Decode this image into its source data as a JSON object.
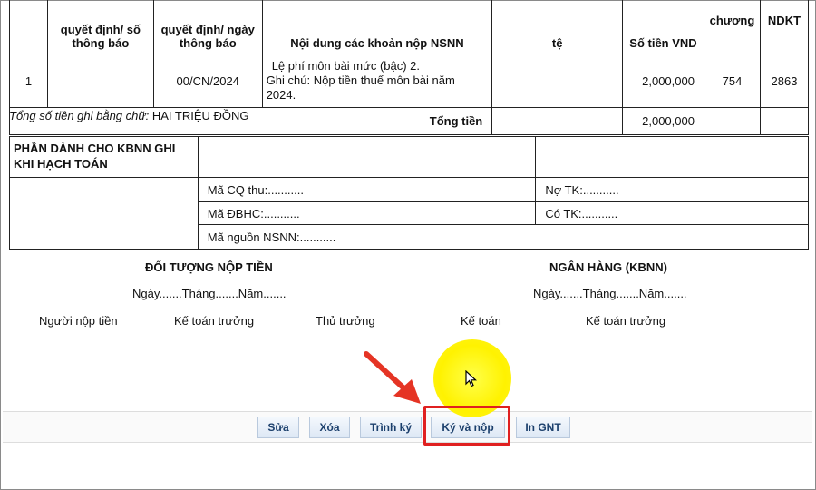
{
  "table_headers": [
    "",
    "quyết định/ số thông báo",
    "quyết định/ ngày thông báo",
    "Nội dung các khoản nộp NSNN",
    "tệ",
    "Số tiền VND",
    "chương",
    "NDKT"
  ],
  "row": {
    "stt": "1",
    "so_thong_bao": "",
    "ngay": "00/CN/2024",
    "noi_dung_1": "Lệ phí môn bài mức (bậc) 2.",
    "noi_dung_2": "Ghi chú: Nộp tiền thuế môn bài năm",
    "noi_dung_3": "2024.",
    "te": "",
    "so_tien": "2,000,000",
    "chuong": "754",
    "ndkt": "2863"
  },
  "total": {
    "label": "Tổng tiền",
    "value": "2,000,000"
  },
  "amount_words": {
    "prefix": "Tổng số tiền ghi bằng chữ:",
    "value": "HAI TRIỆU ĐỒNG"
  },
  "kbnn": {
    "title": "PHẦN DÀNH CHO KBNN GHI KHI HẠCH TOÁN",
    "ma_cq_thu": "Mã CQ thu:...........",
    "no_tk": "Nợ TK:...........",
    "ma_dbhc": "Mã ĐBHC:...........",
    "co_tk": "Có TK:...........",
    "ma_nguon": "Mã nguồn NSNN:..........."
  },
  "signatures": {
    "left_title": "ĐỐI TƯỢNG NỘP TIỀN",
    "right_title": "NGÂN HÀNG (KBNN)",
    "date_left": "Ngày.......Tháng.......Năm.......",
    "date_right": "Ngày.......Tháng.......Năm.......",
    "nguoi_nop": "Người nộp tiền",
    "ke_toan_truong_1": "Kế toán trưởng",
    "thu_truong": "Thủ trưởng",
    "ke_toan": "Kế toán",
    "ke_toan_truong_2": "Kế toán trưởng"
  },
  "buttons": {
    "sua": "Sửa",
    "xoa": "Xóa",
    "trinh_ky": "Trình ký",
    "ky_va_nop": "Ký và nộp",
    "in_gnt": "In GNT"
  },
  "colors": {
    "highlight": "#e02020",
    "cursor_glow": "#fff200",
    "button_text": "#1b3f6c"
  }
}
